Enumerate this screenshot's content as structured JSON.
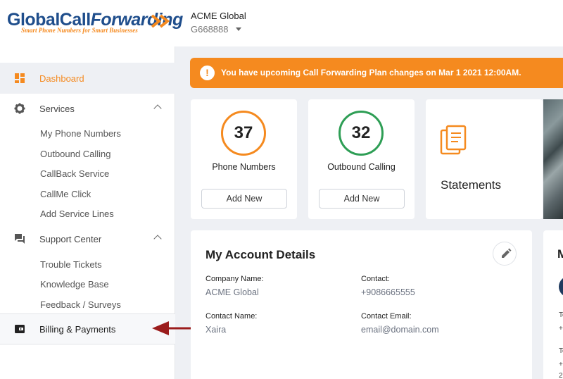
{
  "brand": {
    "logo_global": "Global",
    "logo_call": "Call",
    "logo_forwarding": "Forwarding",
    "logo_tagline": "Smart Phone Numbers for Smart Businesses",
    "orange": "#f58a1f",
    "navy": "#1f4e8c"
  },
  "account": {
    "name": "ACME Global",
    "id": "G668888"
  },
  "sidebar": {
    "dashboard": {
      "label": "Dashboard",
      "icon": "dashboard-icon"
    },
    "services": {
      "label": "Services",
      "icon": "gear-icon",
      "items": [
        "My Phone Numbers",
        "Outbound Calling",
        "CallBack Service",
        "CallMe Click",
        "Add Service Lines"
      ]
    },
    "support": {
      "label": "Support Center",
      "icon": "chat-icon",
      "items": [
        "Trouble Tickets",
        "Knowledge Base",
        "Feedback / Surveys"
      ]
    },
    "billing": {
      "label": "Billing & Payments",
      "icon": "wallet-icon"
    }
  },
  "alert": {
    "icon": "!",
    "text": "You have upcoming Call Forwarding Plan changes on Mar 1 2021 12:00AM."
  },
  "stats": [
    {
      "count": "37",
      "label": "Phone Numbers",
      "button": "Add New",
      "ring_color": "#f58a1f"
    },
    {
      "count": "32",
      "label": "Outbound Calling",
      "button": "Add New",
      "ring_color": "#2e9e55"
    }
  ],
  "statements": {
    "title": "Statements",
    "icon": "statements-icon"
  },
  "details": {
    "title": "My Account Details",
    "company_label": "Company Name:",
    "company_value": "ACME Global",
    "contact_label": "Contact:",
    "contact_value": "+9086665555",
    "contact_name_label": "Contact Name:",
    "contact_name_value": "Xaira",
    "contact_email_label": "Contact Email:",
    "contact_email_value": "email@domain.com"
  },
  "side_card": {
    "title_initial": "M",
    "line1": "To",
    "line2": "+",
    "line3": "To",
    "line4": "+",
    "line5": "2"
  }
}
